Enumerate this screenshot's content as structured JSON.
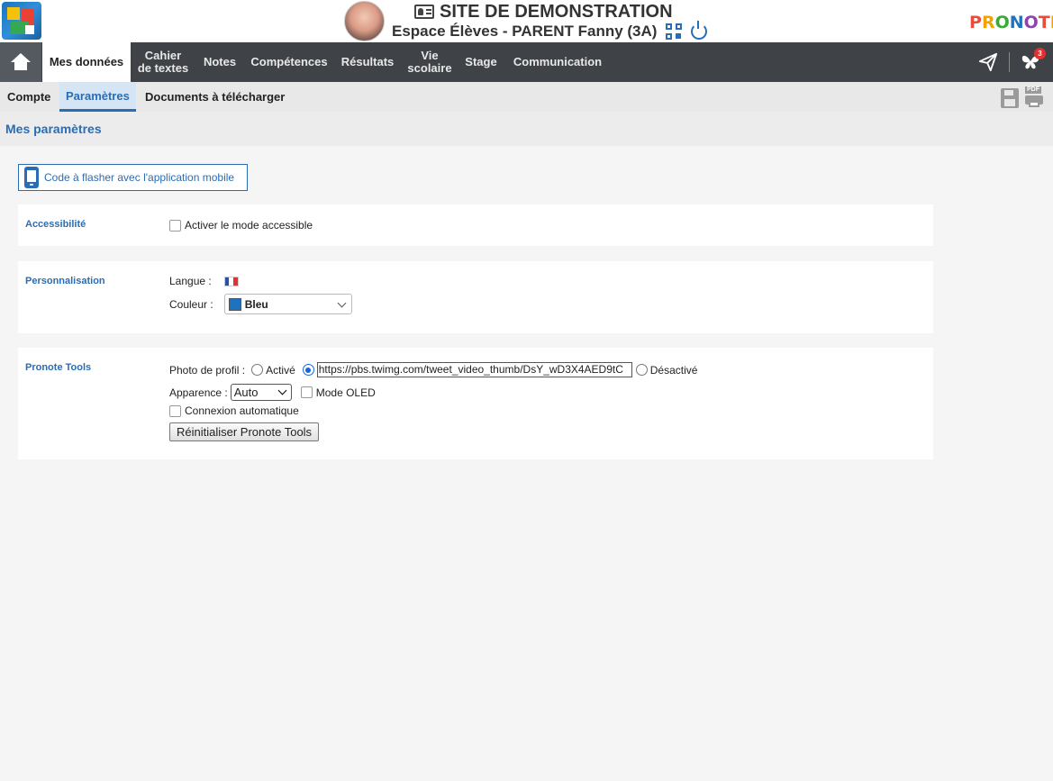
{
  "header": {
    "site_title": "SITE DE DEMONSTRATION",
    "space_title": "Espace Élèves - PARENT Fanny (3A)",
    "brand": "PRONOTE"
  },
  "nav": {
    "items": [
      {
        "label": "Mes données",
        "line2": ""
      },
      {
        "label": "Cahier",
        "line2": "de textes"
      },
      {
        "label": "Notes",
        "line2": ""
      },
      {
        "label": "Compétences",
        "line2": ""
      },
      {
        "label": "Résultats",
        "line2": ""
      },
      {
        "label": "Vie",
        "line2": "scolaire"
      },
      {
        "label": "Stage",
        "line2": ""
      },
      {
        "label": "Communication",
        "line2": ""
      }
    ],
    "active_index": 0,
    "notification_count": "3"
  },
  "subtabs": {
    "items": [
      "Compte",
      "Paramètres",
      "Documents à télécharger"
    ],
    "active_index": 1,
    "pdf_label": "PDF"
  },
  "section": {
    "title": "Mes paramètres"
  },
  "mobile_button": {
    "label": "Code à flasher avec l'application mobile"
  },
  "accessibility": {
    "title": "Accessibilité",
    "checkbox_label": "Activer le mode accessible",
    "checked": false
  },
  "personalisation": {
    "title": "Personnalisation",
    "language_label": "Langue :",
    "color_label": "Couleur :",
    "color_value": "Bleu",
    "color_hex": "#1e73be"
  },
  "pronote_tools": {
    "title": "Pronote Tools",
    "photo_label": "Photo de profil :",
    "active_label": "Activé",
    "url_value": "https://pbs.twimg.com/tweet_video_thumb/DsY_wD3X4AED9tC",
    "disabled_label": "Désactivé",
    "appearance_label": "Apparence :",
    "appearance_value": "Auto",
    "oled_label": "Mode OLED",
    "auto_connect_label": "Connexion automatique",
    "reset_button": "Réinitialiser Pronote Tools"
  },
  "colors": {
    "accent": "#2a6db5",
    "navbar": "#3f4246",
    "background": "#f5f5f5"
  }
}
